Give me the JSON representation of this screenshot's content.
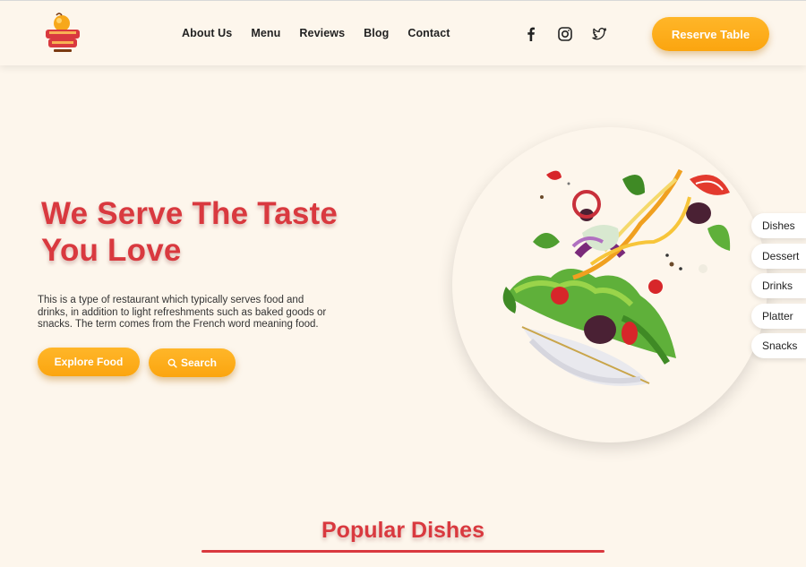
{
  "header": {
    "logo_icon": "restaurant-logo",
    "nav": [
      "About Us",
      "Menu",
      "Reviews",
      "Blog",
      "Contact"
    ],
    "social": [
      "facebook-icon",
      "instagram-icon",
      "twitter-icon"
    ],
    "reserve_label": "Reserve Table"
  },
  "hero": {
    "title_line1": "We Serve The Taste",
    "title_line2": "You Love",
    "description": "This is a type of restaurant which typically serves food and drinks, in addition to light refreshments such as baked goods or snacks. The term comes from the French word meaning food.",
    "explore_label": "Explore Food",
    "search_label": "Search",
    "image": "salad-bowl-image"
  },
  "categories": [
    "Dishes",
    "Dessert",
    "Drinks",
    "Platter",
    "Snacks"
  ],
  "popular": {
    "title": "Popular Dishes"
  },
  "colors": {
    "background": "#fdf6ec",
    "accent_orange": "#fba50f",
    "accent_red": "#d9393f"
  }
}
